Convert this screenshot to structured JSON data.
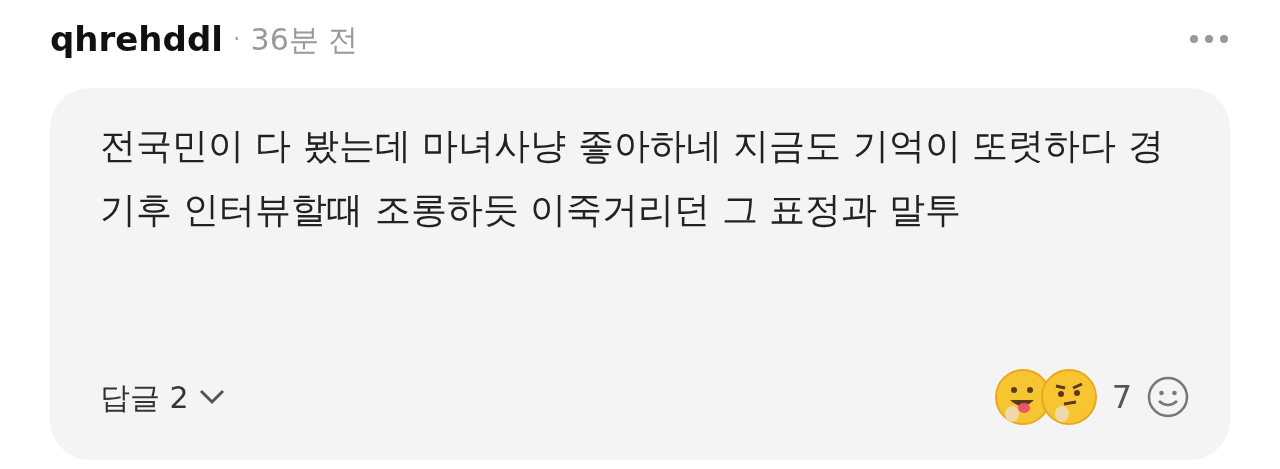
{
  "comment": {
    "author": "qhrehddl",
    "separator": "·",
    "time": "36분 전",
    "text": "전국민이 다 봤는데 마녀사냥 좋아하네 지금도 기억이 또렷하다 경기후 인터뷰할때 조롱하듯 이죽거리던 그 표정과 말투",
    "replies_label": "답글 2",
    "reaction_count": "7"
  }
}
